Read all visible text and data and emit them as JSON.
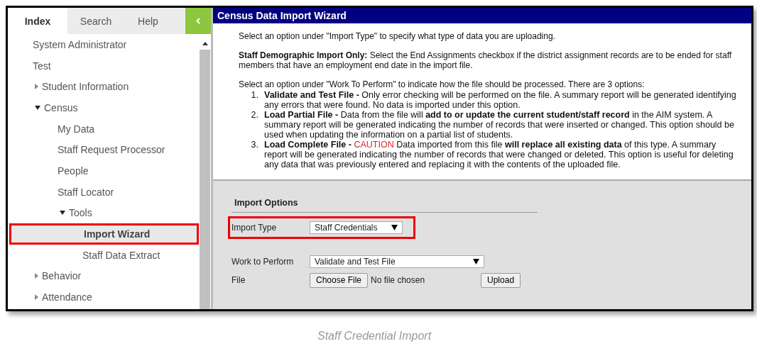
{
  "sidebar": {
    "tabs": [
      {
        "label": "Index",
        "selected": true
      },
      {
        "label": "Search",
        "selected": false
      },
      {
        "label": "Help",
        "selected": false
      }
    ],
    "items": [
      {
        "label": "System Administrator",
        "selected": false,
        "highlighted": false
      },
      {
        "label": "Test",
        "selected": false,
        "highlighted": false
      },
      {
        "label": "Student Information",
        "expanded": false,
        "selected": false,
        "highlighted": false
      },
      {
        "label": "Census",
        "expanded": true,
        "selected": false,
        "highlighted": false,
        "children": [
          {
            "label": "My Data",
            "selected": false,
            "highlighted": false
          },
          {
            "label": "Staff Request Processor",
            "selected": false,
            "highlighted": false
          },
          {
            "label": "People",
            "selected": false,
            "highlighted": false
          },
          {
            "label": "Staff Locator",
            "selected": false,
            "highlighted": false
          },
          {
            "label": "Tools",
            "expanded": true,
            "selected": false,
            "highlighted": false,
            "children": [
              {
                "label": "Import Wizard",
                "selected": true,
                "highlighted": true
              },
              {
                "label": "Staff Data Extract",
                "selected": false,
                "highlighted": false
              }
            ]
          }
        ]
      },
      {
        "label": "Behavior",
        "expanded": false,
        "selected": false,
        "highlighted": false
      },
      {
        "label": "Attendance",
        "expanded": false,
        "selected": false,
        "highlighted": false
      }
    ]
  },
  "panel": {
    "title": "Census Data Import Wizard",
    "paragraphs": [
      "Select an option under \"Import Type\" to specify what type of data you are uploading.",
      "**Staff Demographic Import Only:** Select the End Assignments checkbox if the district assignment records are to be ended for staff members that have an employment end date in the import file.",
      "Select an option under \"Work To Perform\" to indicate how the file should be processed. There are 3 options:"
    ],
    "options": [
      {
        "number": "1.",
        "lead": "Validate and Test File -",
        "text": "Only error checking will be performed on the file. A summary report will be generated identifying any errors that were found. No data is imported under this option."
      },
      {
        "number": "2.",
        "lead": "Load Partial File -",
        "text": "Data from the file will **add to or update the current student/staff record** in the AIM system. A summary report will be generated indicating the number of records that were inserted or changed. This option should be used when updating the information on a partial list of students."
      },
      {
        "number": "3.",
        "lead": "Load Complete File -",
        "warning": "CAUTION",
        "text": "Data imported from this file **will replace all existing data** of this type. A summary report will be generated indicating the number of records that were changed or deleted. This option is useful for deleting any data that was previously entered and replacing it with the contents of the uploaded file."
      }
    ],
    "import_options": {
      "heading": "Import Options",
      "fields": [
        {
          "kind": "select",
          "label": "Import Type",
          "value": "Staff Credentials",
          "highlighted": true
        },
        {
          "kind": "select",
          "label": "Work to Perform",
          "value": "Validate and Test File",
          "highlighted": false
        },
        {
          "kind": "file",
          "label": "File",
          "button": "Choose File",
          "status": "No file chosen",
          "action": "Upload",
          "highlighted": false
        }
      ]
    }
  },
  "caption": "Staff Credential Import"
}
